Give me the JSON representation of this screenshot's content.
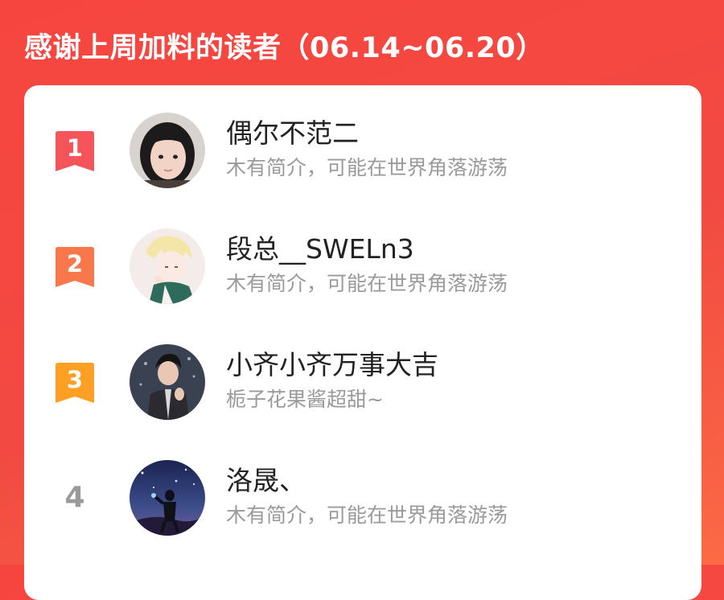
{
  "header": {
    "title": "感谢上周加料的读者（06.14~06.20）"
  },
  "colors": {
    "background": "#f24a42",
    "rank_1": "#f5545a",
    "rank_2": "#f8784c",
    "rank_3": "#ffa025",
    "rank_plain": "#9a9a9a",
    "name_text": "#222222",
    "bio_text": "#9a9a9a"
  },
  "readers": [
    {
      "rank": "1",
      "name": "偶尔不范二",
      "bio": "木有简介，可能在世界角落游荡",
      "avatar_icon": "girl-portrait-avatar",
      "badge": "ribbon-red"
    },
    {
      "rank": "2",
      "name": "段总__SWELn3",
      "bio": "木有简介，可能在世界角落游荡",
      "avatar_icon": "anime-boy-avatar",
      "badge": "ribbon-orange"
    },
    {
      "rank": "3",
      "name": "小齐小齐万事大吉",
      "bio": "栀子花果酱超甜~",
      "avatar_icon": "man-in-suit-avatar",
      "badge": "ribbon-amber"
    },
    {
      "rank": "4",
      "name": "洛晟、",
      "bio": "木有简介，可能在世界角落游荡",
      "avatar_icon": "night-sky-figure-avatar",
      "badge": "plain"
    }
  ]
}
